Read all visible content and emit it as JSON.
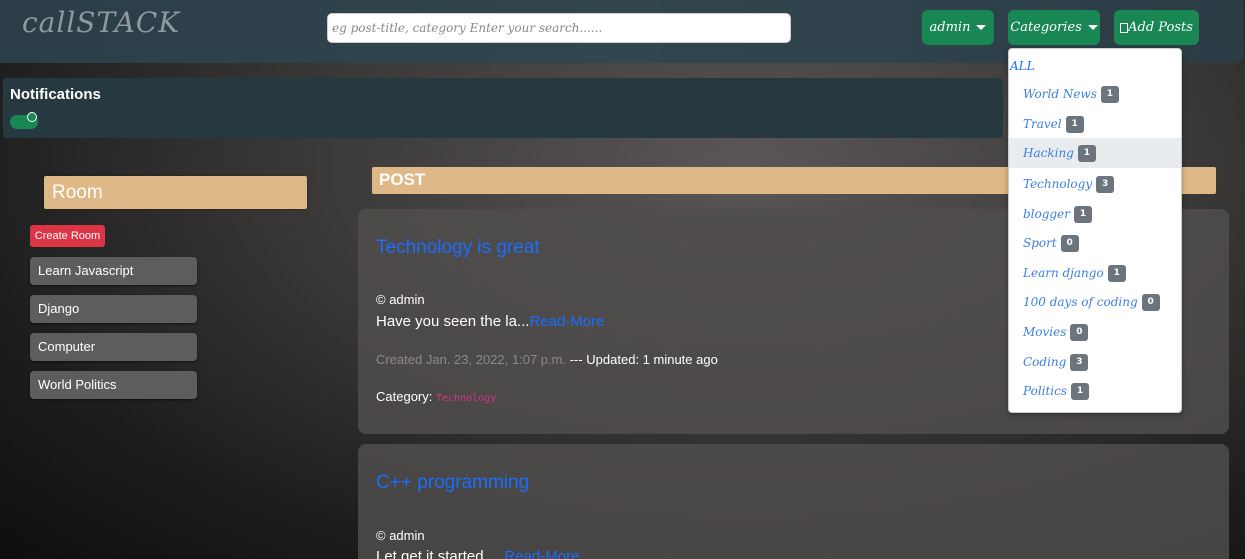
{
  "navbar": {
    "brand": "callSTACK",
    "search_placeholder": "eg post-title, category Enter your search......",
    "user_label": "admin",
    "categories_label": "Categories",
    "add_posts_label": "Add Posts"
  },
  "notifications": {
    "title": "Notifications",
    "toggle_on": true
  },
  "sidebar": {
    "header": "Room",
    "create_label": "Create Room",
    "rooms": [
      "Learn Javascript",
      "Django",
      "Computer",
      "World Politics"
    ]
  },
  "main": {
    "header": "POST",
    "posts": [
      {
        "title": "Technology is great",
        "author": "© admin",
        "excerpt": "Have you seen the la...",
        "read_more": "Read-More",
        "created": "Created Jan. 23, 2022, 1:07 p.m.",
        "updated": " --- Updated: 1 minute ago",
        "category_label": "Category: ",
        "category": "Technology"
      },
      {
        "title": "C++ programming",
        "author": "© admin",
        "excerpt": "Let get it started.....",
        "read_more": "Read-More"
      }
    ]
  },
  "categories_menu": {
    "all_label": "ALL",
    "items": [
      {
        "name": "World News",
        "count": "1"
      },
      {
        "name": "Travel",
        "count": "1"
      },
      {
        "name": "Hacking",
        "count": "1"
      },
      {
        "name": "Technology",
        "count": "3"
      },
      {
        "name": "blogger",
        "count": "1"
      },
      {
        "name": "Sport",
        "count": "0"
      },
      {
        "name": "Learn django",
        "count": "1"
      },
      {
        "name": "100 days of coding",
        "count": "0"
      },
      {
        "name": "Movies",
        "count": "0"
      },
      {
        "name": "Coding",
        "count": "3"
      },
      {
        "name": "Politics",
        "count": "1"
      }
    ]
  },
  "colors": {
    "accent_green": "#198754",
    "accent_tan": "#deb887",
    "link_blue": "#1a6dff",
    "danger_red": "#dc3545"
  }
}
